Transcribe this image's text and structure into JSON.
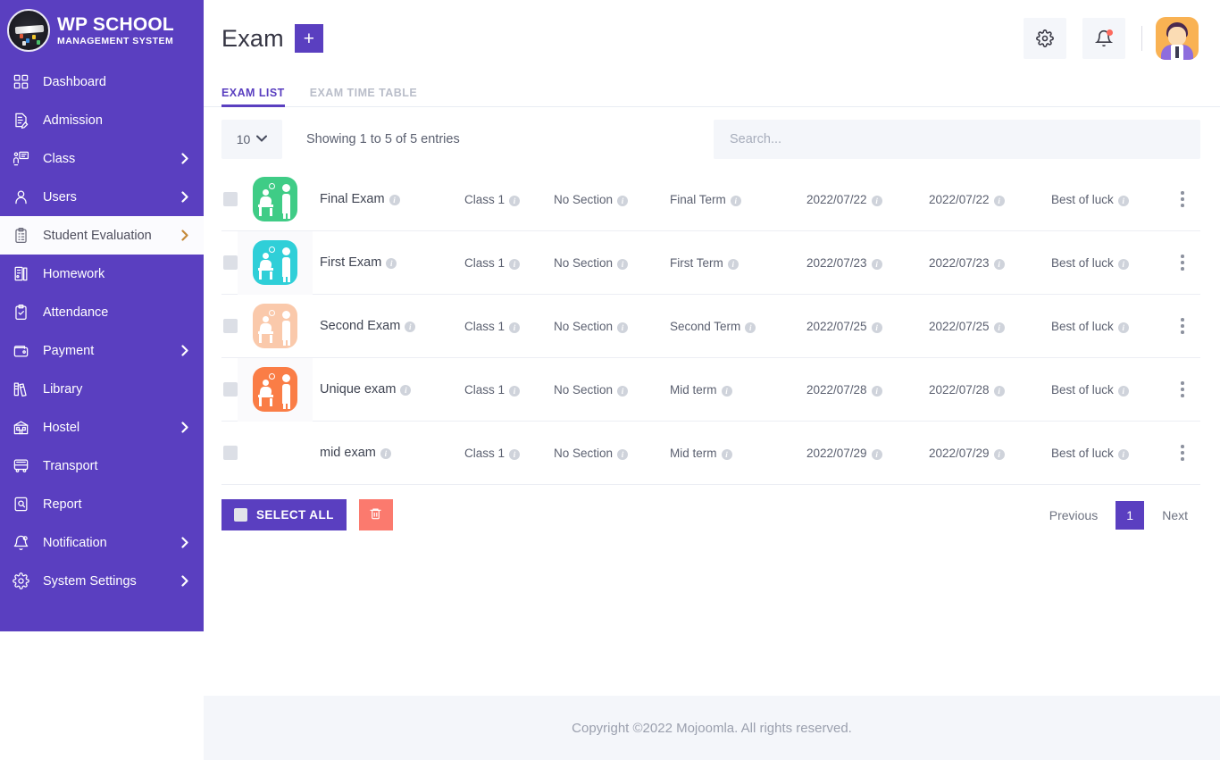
{
  "brand": {
    "logo_icon": "graduation-cap-logo",
    "title": "WP SCHOOL",
    "subtitle": "MANAGEMENT SYSTEM"
  },
  "sidebar": {
    "items": [
      {
        "label": "Dashboard",
        "icon": "grid-icon",
        "has_chevron": false,
        "active": false
      },
      {
        "label": "Admission",
        "icon": "document-edit-icon",
        "has_chevron": false,
        "active": false
      },
      {
        "label": "Class",
        "icon": "classroom-icon",
        "has_chevron": true,
        "active": false
      },
      {
        "label": "Users",
        "icon": "user-icon",
        "has_chevron": true,
        "active": false
      },
      {
        "label": "Student Evaluation",
        "icon": "clipboard-list-icon",
        "has_chevron": true,
        "active": true
      },
      {
        "label": "Homework",
        "icon": "books-icon",
        "has_chevron": false,
        "active": false
      },
      {
        "label": "Attendance",
        "icon": "clipboard-check-icon",
        "has_chevron": false,
        "active": false
      },
      {
        "label": "Payment",
        "icon": "wallet-icon",
        "has_chevron": true,
        "active": false
      },
      {
        "label": "Library",
        "icon": "library-icon",
        "has_chevron": false,
        "active": false
      },
      {
        "label": "Hostel",
        "icon": "building-icon",
        "has_chevron": true,
        "active": false
      },
      {
        "label": "Transport",
        "icon": "bus-icon",
        "has_chevron": false,
        "active": false
      },
      {
        "label": "Report",
        "icon": "report-icon",
        "has_chevron": false,
        "active": false
      },
      {
        "label": "Notification",
        "icon": "bell-icon",
        "has_chevron": true,
        "active": false
      },
      {
        "label": "System Settings",
        "icon": "gear-icon",
        "has_chevron": true,
        "active": false
      }
    ],
    "chevron_glyph": "›"
  },
  "header": {
    "title": "Exam",
    "add_button_label": "+",
    "settings_icon": "gear-icon",
    "notifications_icon": "bell-icon",
    "notification_badge": true,
    "avatar_icon": "user-avatar"
  },
  "tabs": [
    {
      "label": "EXAM LIST",
      "active": true
    },
    {
      "label": "EXAM TIME TABLE",
      "active": false
    }
  ],
  "controls": {
    "page_length": "10",
    "page_length_caret": "⌄",
    "showing_text": "Showing 1 to 5 of 5 entries",
    "search_placeholder": "Search...",
    "search_value": ""
  },
  "table": {
    "info_glyph": "i",
    "rows": [
      {
        "icon": "exam-icon",
        "icon_color": "#3fcc86",
        "name": "Final Exam",
        "class": "Class 1",
        "section": "No Section",
        "term": "Final Term",
        "start_date": "2022/07/22",
        "end_date": "2022/07/22",
        "note": "Best of luck",
        "checked": false
      },
      {
        "icon": "exam-icon",
        "icon_color": "#2fcfd8",
        "name": "First Exam",
        "class": "Class 1",
        "section": "No Section",
        "term": "First Term",
        "start_date": "2022/07/23",
        "end_date": "2022/07/23",
        "note": "Best of luck",
        "checked": false
      },
      {
        "icon": "exam-icon",
        "icon_color": "#fac9ab",
        "name": "Second Exam",
        "class": "Class 1",
        "section": "No Section",
        "term": "Second Term",
        "start_date": "2022/07/25",
        "end_date": "2022/07/25",
        "note": "Best of luck",
        "checked": false
      },
      {
        "icon": "exam-icon",
        "icon_color": "#fa7d46",
        "name": "Unique exam",
        "class": "Class 1",
        "section": "No Section",
        "term": "Mid term",
        "start_date": "2022/07/28",
        "end_date": "2022/07/28",
        "note": "Best of luck",
        "checked": false
      },
      {
        "icon": "exam-icon",
        "icon_color": "#fbb council",
        "name": "mid exam",
        "class": "Class 1",
        "section": "No Section",
        "term": "Mid term",
        "start_date": "2022/07/29",
        "end_date": "2022/07/29",
        "note": "Best of luck",
        "checked": false
      }
    ]
  },
  "footer_controls": {
    "select_all_label": "SELECT ALL",
    "delete_icon": "trash-icon",
    "pagination": {
      "previous_label": "Previous",
      "current_page": "1",
      "next_label": "Next"
    }
  },
  "page_footer": {
    "copyright": "Copyright ©2022 Mojoomla. All rights reserved."
  },
  "colors": {
    "brand_purple": "#5a3fc0",
    "danger_red": "#fb7a6e",
    "panel_bg": "#f4f6fa",
    "text_muted": "#9ba0ae"
  }
}
